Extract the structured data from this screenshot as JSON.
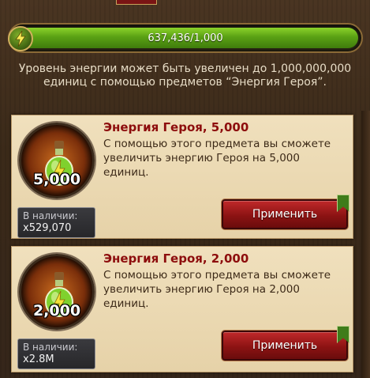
{
  "energy": {
    "value": "637,436/1,000",
    "fill_fraction": 1.0,
    "icon": "lightning-icon"
  },
  "info": {
    "text": "Уровень энергии может быть увеличен до 1,000,000,000 единиц с помощью предметов “Энергия Героя”."
  },
  "items": [
    {
      "title": "Энергия Героя, 5,000",
      "description": "С помощью этого предмета вы сможете увеличить энергию Героя на 5,000 единиц.",
      "slot_amount": "5,000",
      "stock_label": "В наличии:",
      "stock_qty": "x529,070",
      "button_label": "Применить",
      "icon": "energy-potion-icon"
    },
    {
      "title": "Энергия Героя, 2,000",
      "description": "С помощью этого предмета вы сможете увеличить энергию Героя на 2,000 единиц.",
      "slot_amount": "2,000",
      "stock_label": "В наличии:",
      "stock_qty": "x2.8M",
      "button_label": "Применить",
      "icon": "energy-potion-icon"
    }
  ],
  "colors": {
    "energy_fill": "#5aa114",
    "title_red": "#8d0d0d",
    "button_red": "#8c1313",
    "card_bg": "#ecdcb6"
  }
}
